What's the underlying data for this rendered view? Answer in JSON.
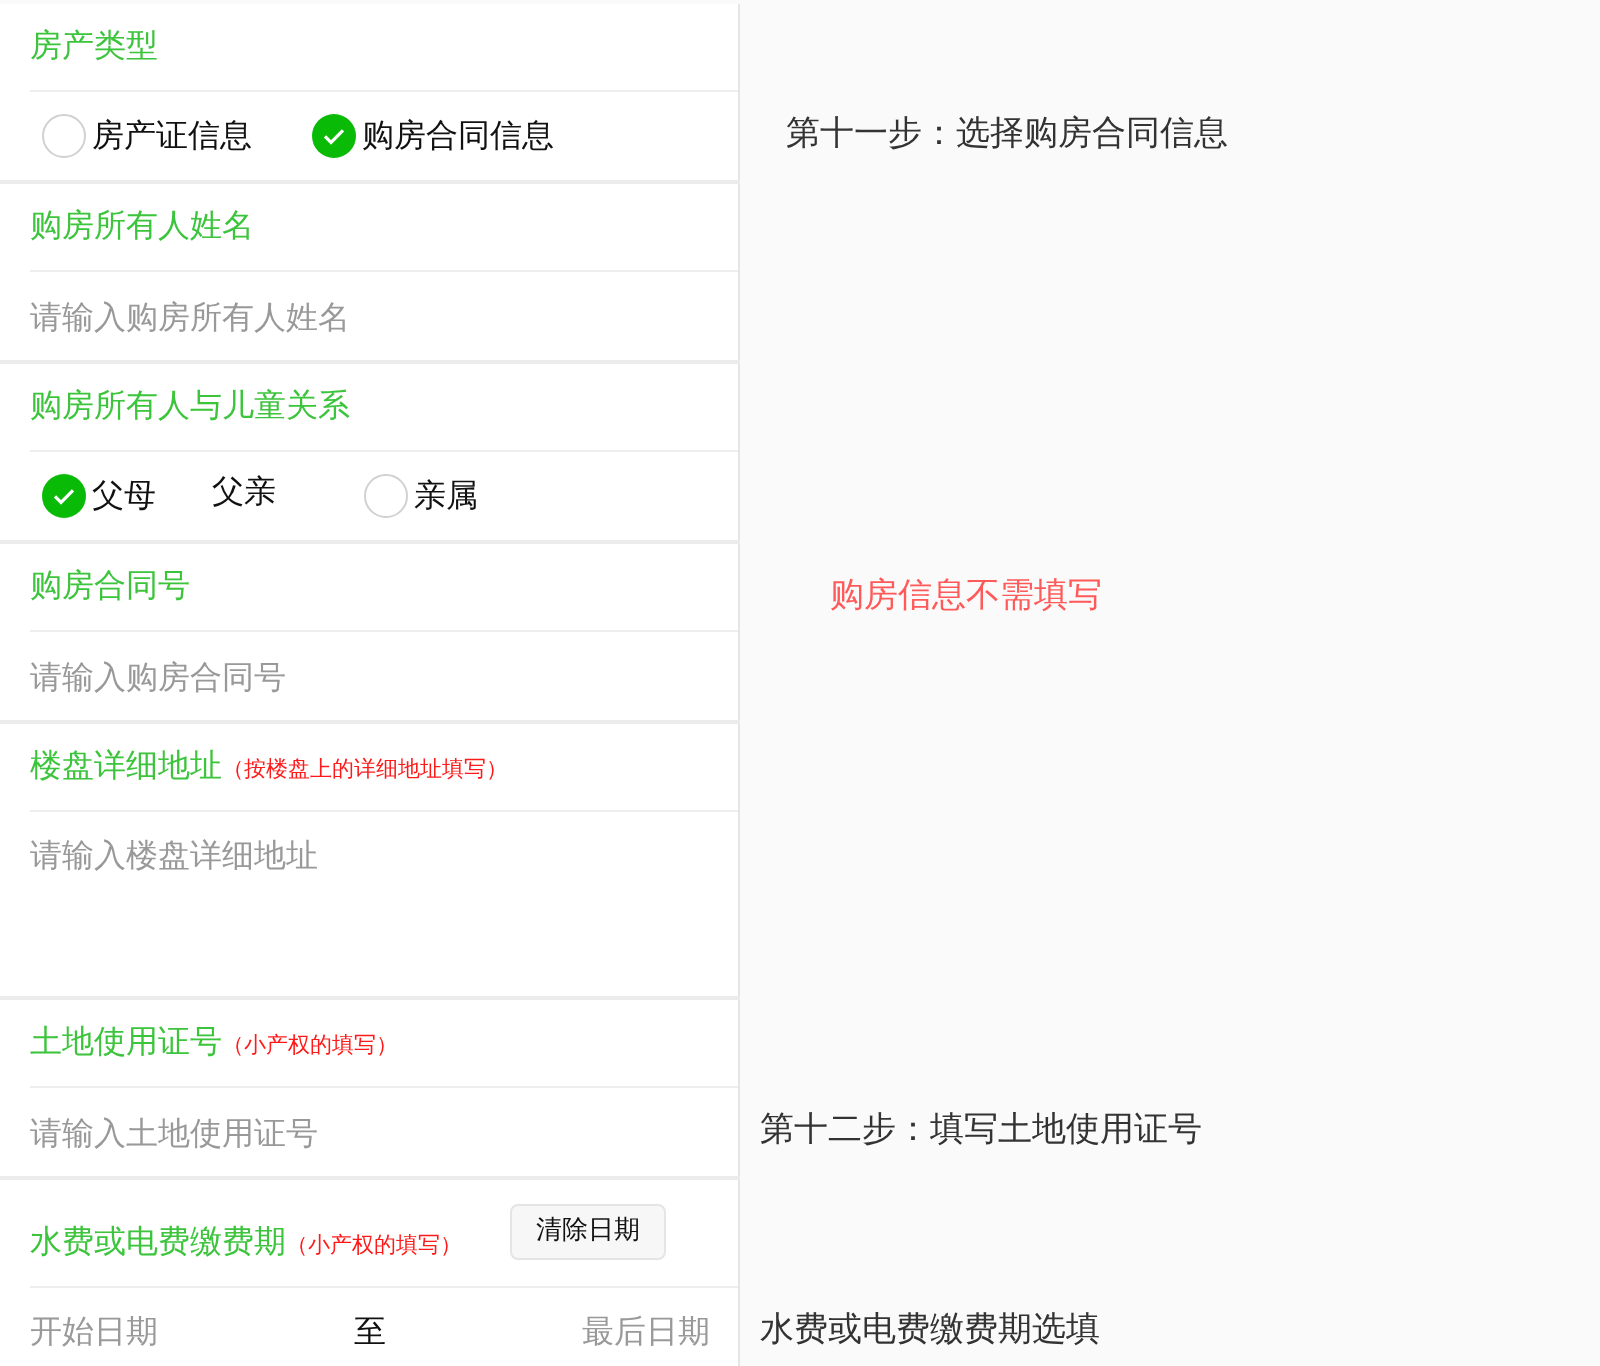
{
  "sections": [
    {
      "label": "房产类型",
      "kind": "radio",
      "options": [
        {
          "label": "房产证信息",
          "kind": "radio",
          "checked": false
        },
        {
          "label": "购房合同信息",
          "kind": "radio",
          "checked": true
        }
      ],
      "note": {
        "text": "第十一步：选择购房合同信息",
        "kind": "step",
        "beside_label": false
      }
    },
    {
      "label": "购房所有人姓名",
      "kind": "input",
      "placeholder": "请输入购房所有人姓名"
    },
    {
      "label": "购房所有人与儿童关系",
      "kind": "radio",
      "options": [
        {
          "label": "父母",
          "kind": "radio",
          "checked": true
        },
        {
          "label": "父亲",
          "kind": "text"
        },
        {
          "label": "亲属",
          "kind": "radio",
          "checked": false
        }
      ]
    },
    {
      "label": "购房合同号",
      "kind": "input",
      "placeholder": "请输入购房合同号",
      "note": {
        "text": "购房信息不需填写",
        "kind": "alert",
        "beside_label": true
      }
    },
    {
      "label": "楼盘详细地址",
      "hint": "（按楼盘上的详细地址填写）",
      "kind": "textarea",
      "placeholder": "请输入楼盘详细地址"
    },
    {
      "label": "土地使用证号",
      "hint": "（小产权的填写）",
      "kind": "input",
      "placeholder": "请输入土地使用证号",
      "note": {
        "text": "第十二步：填写土地使用证号",
        "kind": "step",
        "beside_label": false
      }
    },
    {
      "label": "水费或电费缴费期",
      "hint": "（小产权的填写）",
      "kind": "daterange",
      "button": "清除日期",
      "start_placeholder": "开始日期",
      "separator": "至",
      "end_placeholder": "最后日期",
      "note": {
        "text": "水费或电费缴费期选填",
        "kind": "step",
        "beside_label": false
      }
    }
  ]
}
